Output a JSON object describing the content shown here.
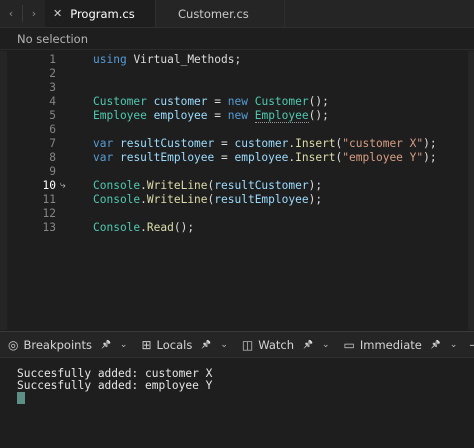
{
  "tabs": {
    "back_label": "‹",
    "forward_label": "›",
    "close_label": "✕",
    "active": "Program.cs",
    "inactive": "Customer.cs"
  },
  "selection": {
    "label": "No selection"
  },
  "editor": {
    "lines": [
      {
        "n": "1",
        "parts": [
          [
            "kw",
            "using"
          ],
          [
            "plain",
            " "
          ],
          [
            "ns",
            "Virtual_Methods"
          ],
          [
            "plain",
            ";"
          ]
        ]
      },
      {
        "n": "2",
        "parts": []
      },
      {
        "n": "3",
        "parts": []
      },
      {
        "n": "4",
        "parts": [
          [
            "type",
            "Customer"
          ],
          [
            "plain",
            " "
          ],
          [
            "var",
            "customer"
          ],
          [
            "plain",
            " = "
          ],
          [
            "kw",
            "new"
          ],
          [
            "plain",
            " "
          ],
          [
            "type",
            "Customer"
          ],
          [
            "plain",
            "();"
          ]
        ]
      },
      {
        "n": "5",
        "parts": [
          [
            "type",
            "Employee"
          ],
          [
            "plain",
            " "
          ],
          [
            "var",
            "employee"
          ],
          [
            "plain",
            " = "
          ],
          [
            "kw",
            "new"
          ],
          [
            "plain",
            " "
          ],
          [
            "typehl",
            "Employee"
          ],
          [
            "plain",
            "();"
          ]
        ]
      },
      {
        "n": "6",
        "parts": []
      },
      {
        "n": "7",
        "parts": [
          [
            "kw",
            "var"
          ],
          [
            "plain",
            " "
          ],
          [
            "var",
            "resultCustomer"
          ],
          [
            "plain",
            " = "
          ],
          [
            "var",
            "customer"
          ],
          [
            "plain",
            "."
          ],
          [
            "method",
            "Insert"
          ],
          [
            "plain",
            "("
          ],
          [
            "str",
            "\"customer X\""
          ],
          [
            "plain",
            ");"
          ]
        ]
      },
      {
        "n": "8",
        "parts": [
          [
            "kw",
            "var"
          ],
          [
            "plain",
            " "
          ],
          [
            "var",
            "resultEmployee"
          ],
          [
            "plain",
            " = "
          ],
          [
            "var",
            "employee"
          ],
          [
            "plain",
            "."
          ],
          [
            "method",
            "Insert"
          ],
          [
            "plain",
            "("
          ],
          [
            "str",
            "\"employee Y\""
          ],
          [
            "plain",
            ");"
          ]
        ]
      },
      {
        "n": "9",
        "parts": []
      },
      {
        "n": "10",
        "current": true,
        "parts": [
          [
            "type",
            "Console"
          ],
          [
            "plain",
            "."
          ],
          [
            "method",
            "WriteLine"
          ],
          [
            "plain",
            "("
          ],
          [
            "var",
            "resultCustomer"
          ],
          [
            "plain",
            ");"
          ]
        ]
      },
      {
        "n": "11",
        "parts": [
          [
            "type",
            "Console"
          ],
          [
            "plain",
            "."
          ],
          [
            "method",
            "WriteLine"
          ],
          [
            "plain",
            "("
          ],
          [
            "var",
            "resultEmployee"
          ],
          [
            "plain",
            ");"
          ]
        ]
      },
      {
        "n": "12",
        "parts": []
      },
      {
        "n": "13",
        "parts": [
          [
            "type",
            "Console"
          ],
          [
            "plain",
            "."
          ],
          [
            "method",
            "Read"
          ],
          [
            "plain",
            "();"
          ]
        ]
      }
    ]
  },
  "panel": {
    "tabs": [
      {
        "label": "Breakpoints",
        "icon": "breakpoints-icon",
        "glyph": "◎",
        "pin": "✎"
      },
      {
        "label": "Locals",
        "icon": "locals-icon",
        "glyph": "⊞",
        "pin": "✎"
      },
      {
        "label": "Watch",
        "icon": "watch-icon",
        "glyph": "◫",
        "pin": "✎"
      },
      {
        "label": "Immediate",
        "icon": "immediate-icon",
        "glyph": "▭",
        "pin": "✎"
      }
    ]
  },
  "output": {
    "lines": [
      "Succesfully added: customer X",
      "Succesfully added: employee Y"
    ]
  }
}
